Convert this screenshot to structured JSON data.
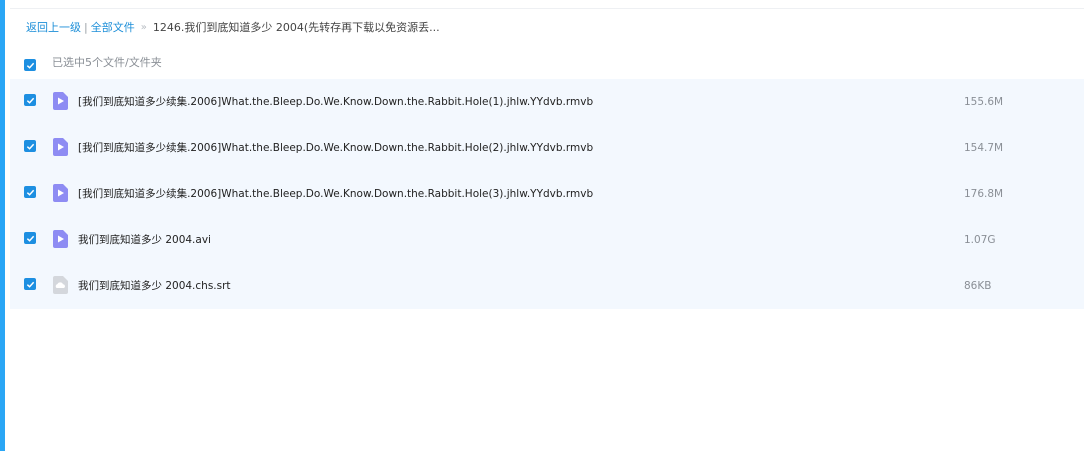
{
  "breadcrumb": {
    "back": "返回上一级",
    "separator": "|",
    "all_files": "全部文件",
    "arrow": "»",
    "current": "1246.我们到底知道多少 2004(先转存再下载以免资源丢..."
  },
  "selection": {
    "label": "已选中5个文件/文件夹",
    "all_checked": true
  },
  "files": [
    {
      "name": "[我们到底知道多少续集.2006]What.the.Bleep.Do.We.Know.Down.the.Rabbit.Hole(1).jhlw.YYdvb.rmvb",
      "size": "155.6M",
      "icon": "video-file-icon",
      "checked": true
    },
    {
      "name": "[我们到底知道多少续集.2006]What.the.Bleep.Do.We.Know.Down.the.Rabbit.Hole(2).jhlw.YYdvb.rmvb",
      "size": "154.7M",
      "icon": "video-file-icon",
      "checked": true
    },
    {
      "name": "[我们到底知道多少续集.2006]What.the.Bleep.Do.We.Know.Down.the.Rabbit.Hole(3).jhlw.YYdvb.rmvb",
      "size": "176.8M",
      "icon": "video-file-icon",
      "checked": true
    },
    {
      "name": "我们到底知道多少 2004.avi",
      "size": "1.07G",
      "icon": "video-file-icon",
      "checked": true
    },
    {
      "name": "我们到底知道多少 2004.chs.srt",
      "size": "86KB",
      "icon": "subtitle-file-icon",
      "checked": true
    }
  ],
  "colors": {
    "accent": "#1d8fe1",
    "side_bar": "#2aa6f5",
    "list_bg": "#f3f8fe",
    "video_icon": "#8e8cf3",
    "subtitle_icon": "#d4d7dc"
  }
}
